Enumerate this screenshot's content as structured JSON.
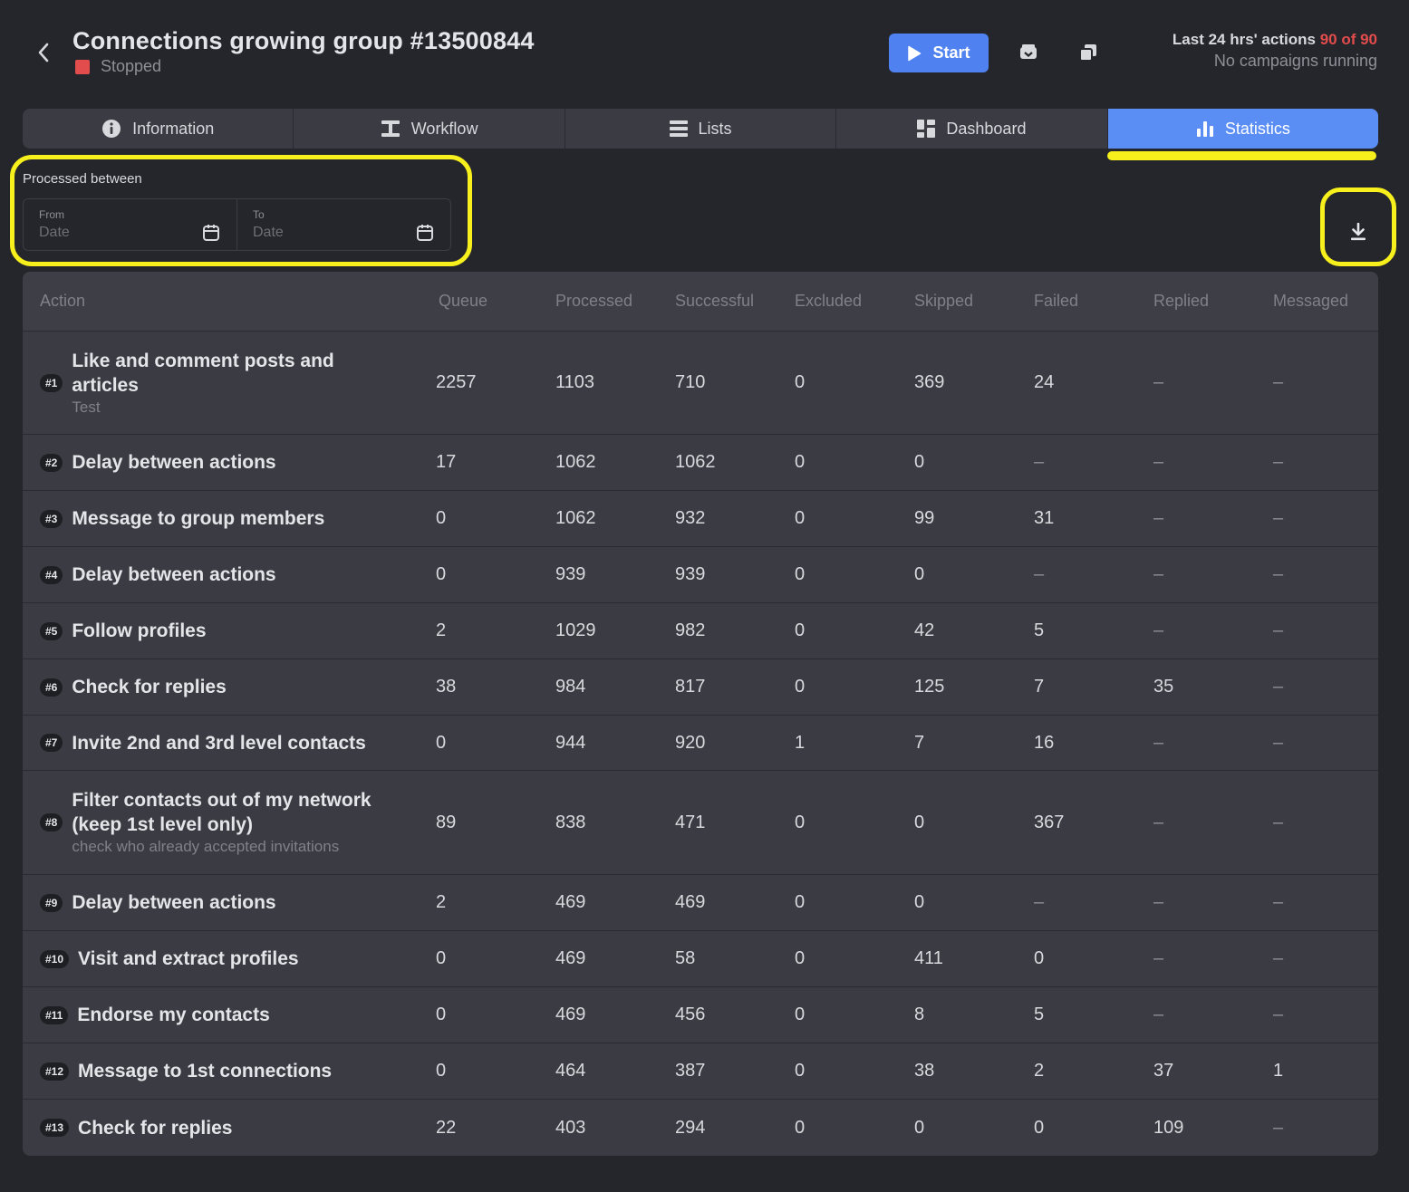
{
  "header": {
    "title": "Connections growing group #13500844",
    "status": "Stopped",
    "start_label": "Start",
    "quota_label": "Last 24 hrs' actions",
    "quota_count": "90 of 90",
    "campaigns_status": "No campaigns running"
  },
  "tabs": [
    {
      "label": "Information",
      "icon": "info-icon",
      "active": false
    },
    {
      "label": "Workflow",
      "icon": "workflow-icon",
      "active": false
    },
    {
      "label": "Lists",
      "icon": "list-icon",
      "active": false
    },
    {
      "label": "Dashboard",
      "icon": "dashboard-icon",
      "active": false
    },
    {
      "label": "Statistics",
      "icon": "bar-chart-icon",
      "active": true
    }
  ],
  "filter": {
    "label": "Processed between",
    "from_caption": "From",
    "from_placeholder": "Date",
    "to_caption": "To",
    "to_placeholder": "Date"
  },
  "table": {
    "columns": [
      "Action",
      "Queue",
      "Processed",
      "Successful",
      "Excluded",
      "Skipped",
      "Failed",
      "Replied",
      "Messaged"
    ],
    "rows": [
      {
        "num": "#1",
        "name": "Like and comment posts and articles",
        "sub": "Test",
        "values": [
          "2257",
          "1103",
          "710",
          "0",
          "369",
          "24",
          "–",
          "–"
        ]
      },
      {
        "num": "#2",
        "name": "Delay between actions",
        "sub": "",
        "values": [
          "17",
          "1062",
          "1062",
          "0",
          "0",
          "–",
          "–",
          "–"
        ]
      },
      {
        "num": "#3",
        "name": "Message to group members",
        "sub": "",
        "values": [
          "0",
          "1062",
          "932",
          "0",
          "99",
          "31",
          "–",
          "–"
        ]
      },
      {
        "num": "#4",
        "name": "Delay between actions",
        "sub": "",
        "values": [
          "0",
          "939",
          "939",
          "0",
          "0",
          "–",
          "–",
          "–"
        ]
      },
      {
        "num": "#5",
        "name": "Follow profiles",
        "sub": "",
        "values": [
          "2",
          "1029",
          "982",
          "0",
          "42",
          "5",
          "–",
          "–"
        ]
      },
      {
        "num": "#6",
        "name": "Check for replies",
        "sub": "",
        "values": [
          "38",
          "984",
          "817",
          "0",
          "125",
          "7",
          "35",
          "–"
        ]
      },
      {
        "num": "#7",
        "name": "Invite 2nd and 3rd level contacts",
        "sub": "",
        "values": [
          "0",
          "944",
          "920",
          "1",
          "7",
          "16",
          "–",
          "–"
        ]
      },
      {
        "num": "#8",
        "name": "Filter contacts out of my network (keep 1st level only)",
        "sub": "check who already accepted invitations",
        "values": [
          "89",
          "838",
          "471",
          "0",
          "0",
          "367",
          "–",
          "–"
        ]
      },
      {
        "num": "#9",
        "name": "Delay between actions",
        "sub": "",
        "values": [
          "2",
          "469",
          "469",
          "0",
          "0",
          "–",
          "–",
          "–"
        ]
      },
      {
        "num": "#10",
        "name": "Visit and extract profiles",
        "sub": "",
        "values": [
          "0",
          "469",
          "58",
          "0",
          "411",
          "0",
          "–",
          "–"
        ]
      },
      {
        "num": "#11",
        "name": "Endorse my contacts",
        "sub": "",
        "values": [
          "0",
          "469",
          "456",
          "0",
          "8",
          "5",
          "–",
          "–"
        ]
      },
      {
        "num": "#12",
        "name": "Message to 1st connections",
        "sub": "",
        "values": [
          "0",
          "464",
          "387",
          "0",
          "38",
          "2",
          "37",
          "1"
        ]
      },
      {
        "num": "#13",
        "name": "Check for replies",
        "sub": "",
        "values": [
          "22",
          "403",
          "294",
          "0",
          "0",
          "0",
          "109",
          "–"
        ]
      }
    ]
  },
  "colors": {
    "accent": "#5b8ef5",
    "start_button": "#4f82f0",
    "status_stopped": "#e24c4c",
    "highlight": "#f7f01c",
    "background": "#25262b",
    "table_bg": "#3b3c43"
  }
}
